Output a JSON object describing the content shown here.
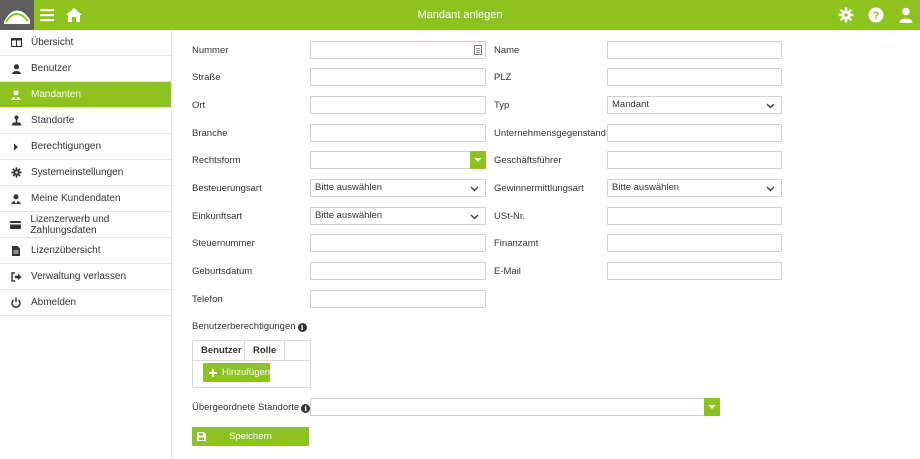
{
  "header": {
    "title": "Mandant anlegen",
    "icons": [
      "logo-icon",
      "menu-icon",
      "home-icon",
      "settings-icon",
      "help-icon",
      "user-icon"
    ]
  },
  "sidebar": {
    "items": [
      {
        "label": "Übersicht",
        "icon": "table-icon",
        "active": false
      },
      {
        "label": "Benutzer",
        "icon": "user-icon",
        "active": false
      },
      {
        "label": "Mandanten",
        "icon": "client-icon",
        "active": true
      },
      {
        "label": "Standorte",
        "icon": "location-icon",
        "active": false
      },
      {
        "label": "Berechtigungen",
        "icon": "caret-right-icon",
        "active": false
      },
      {
        "label": "Systemeinstellungen",
        "icon": "gear-icon",
        "active": false
      },
      {
        "label": "Meine Kundendaten",
        "icon": "customer-icon",
        "active": false
      },
      {
        "label": "Lizenzerwerb und Zahlungsdaten",
        "icon": "credit-card-icon",
        "active": false
      },
      {
        "label": "Lizenzübersicht",
        "icon": "file-icon",
        "active": false
      },
      {
        "label": "Verwaltung verlassen",
        "icon": "sign-out-icon",
        "active": false
      },
      {
        "label": "Abmelden",
        "icon": "power-icon",
        "active": false
      }
    ]
  },
  "form": {
    "nummer": {
      "label": "Nummer",
      "value": ""
    },
    "name": {
      "label": "Name",
      "value": ""
    },
    "strasse": {
      "label": "Straße",
      "value": ""
    },
    "plz": {
      "label": "PLZ",
      "value": ""
    },
    "ort": {
      "label": "Ort",
      "value": ""
    },
    "typ": {
      "label": "Typ",
      "value": "Mandant"
    },
    "branche": {
      "label": "Branche",
      "value": ""
    },
    "unternehmensgegenstand": {
      "label": "Unternehmensgegenstand",
      "value": ""
    },
    "rechtsform": {
      "label": "Rechtsform",
      "value": ""
    },
    "geschaeftsfuehrer": {
      "label": "Geschäftsführer",
      "value": ""
    },
    "besteuerungsart": {
      "label": "Besteuerungsart",
      "value": "Bitte auswählen"
    },
    "gewinnermittlungsart": {
      "label": "Gewinnermittlungsart",
      "value": "Bitte auswählen"
    },
    "einkunftsart": {
      "label": "Einkunftsart",
      "value": "Bitte auswählen"
    },
    "ustnr": {
      "label": "USt-Nr.",
      "value": ""
    },
    "steuernummer": {
      "label": "Steuernummer",
      "value": ""
    },
    "finanzamt": {
      "label": "Finanzamt",
      "value": ""
    },
    "geburtsdatum": {
      "label": "Geburtsdatum",
      "value": ""
    },
    "email": {
      "label": "E-Mail",
      "value": ""
    },
    "telefon": {
      "label": "Telefon",
      "value": ""
    },
    "benutzerberechtigungen": {
      "label": "Benutzerberechtigungen",
      "columns": [
        "Benutzer",
        "Rolle"
      ],
      "add_label": "Hinzufügen"
    },
    "uebergeordnete_standorte": {
      "label": "Übergeordnete Standorte",
      "value": ""
    },
    "save_label": "Speichern"
  },
  "colors": {
    "accent": "#8dc21f",
    "text": "#333333",
    "border": "#cfcfcf"
  }
}
